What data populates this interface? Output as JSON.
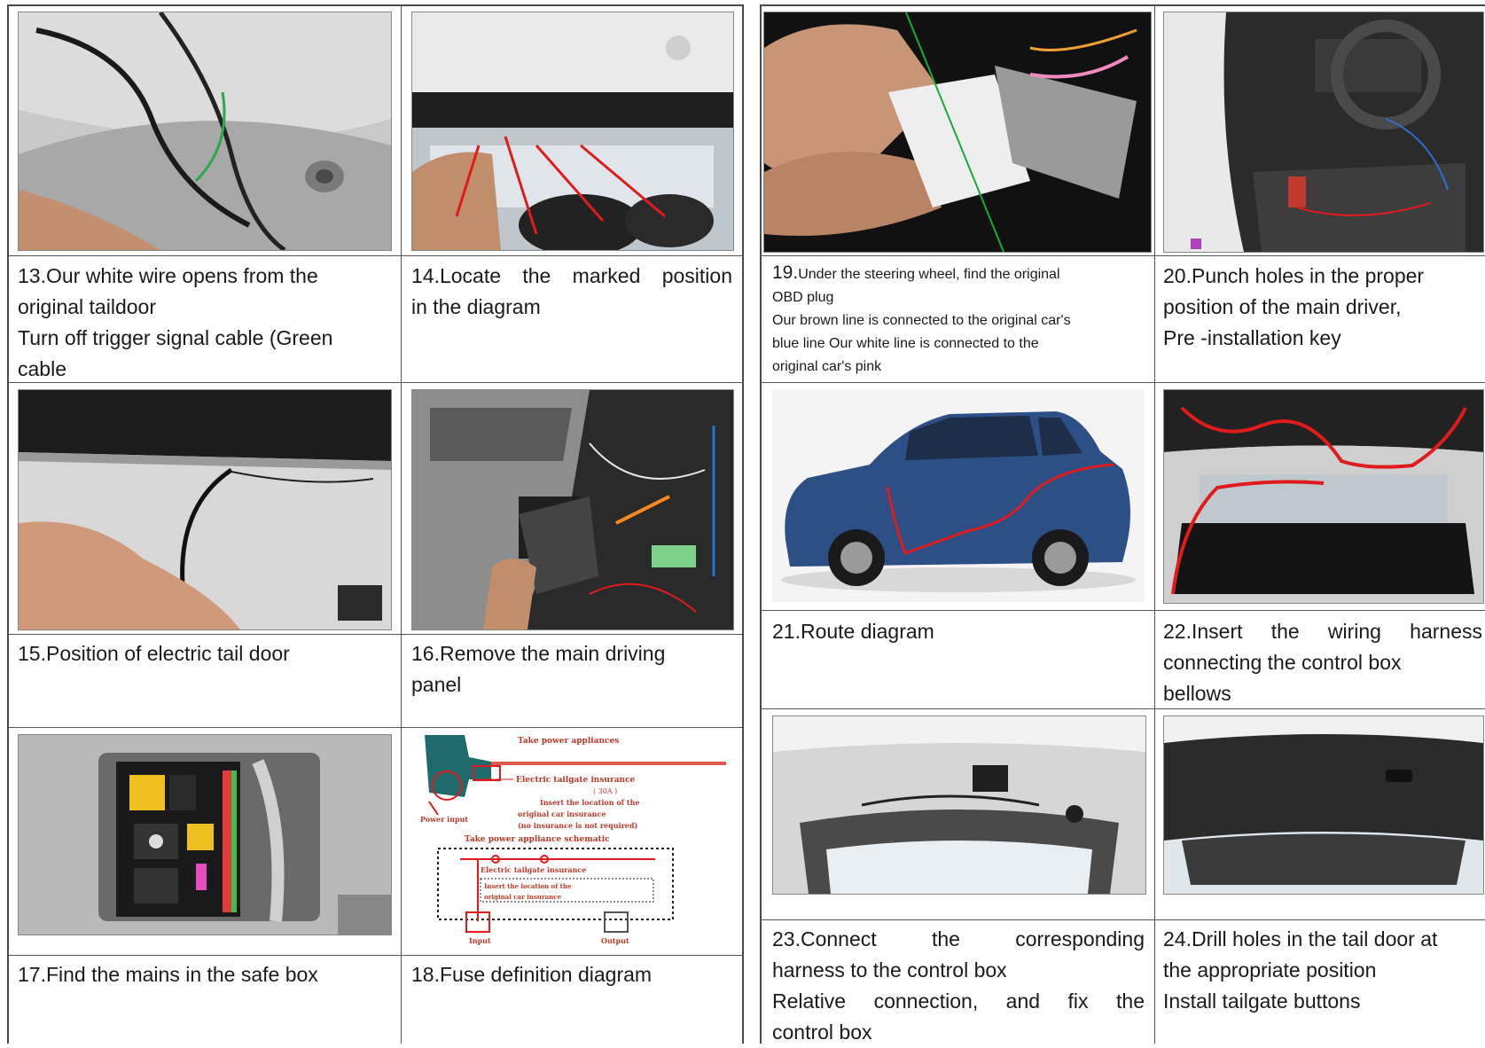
{
  "left": {
    "step13": {
      "lines": [
        "13.Our white wire opens from the",
        "original taildoor",
        "Turn off trigger signal cable (Green",
        "cable"
      ]
    },
    "step14": {
      "lines": [
        "14.Locate the marked position",
        "in the diagram"
      ]
    },
    "step15": {
      "lines": [
        "15.Position of electric tail door"
      ]
    },
    "step16": {
      "lines": [
        "16.Remove the main driving",
        "panel"
      ]
    },
    "step17": {
      "lines": [
        "17.Find the mains in the safe box"
      ]
    },
    "step18": {
      "lines": [
        "18.Fuse definition diagram"
      ],
      "diagram": {
        "top_label": "Take power appliances",
        "fuse_label": "Electric tailgate insurance",
        "amp": "( 30A )",
        "insert_label": "Insert the location of the",
        "insert_label2": "original car insurance",
        "note": "(no insurance is not required)",
        "power_input": "Power input",
        "schematic_title": "Take power appliance schematic",
        "schematic_fuse": "Electric tailgate insurance",
        "schematic_insert": "Insert the location of the",
        "schematic_insert2": "original car insurance",
        "input": "Input",
        "output": "Output"
      }
    }
  },
  "right": {
    "step19": {
      "first": "19.",
      "lines": [
        "Under the steering wheel, find the original",
        "OBD plug",
        "Our brown line is connected to the original car's",
        "blue line Our white line is connected to the",
        "original car's pink"
      ]
    },
    "step20": {
      "lines": [
        "20.Punch holes in the proper",
        "position of the main driver,",
        "Pre -installation key"
      ]
    },
    "step21": {
      "lines": [
        "21.Route diagram"
      ]
    },
    "step22": {
      "lines": [
        "22.Insert the wiring harness",
        "connecting the control box",
        "bellows"
      ]
    },
    "step23": {
      "lines": [
        "23.Connect the corresponding",
        "harness to the control box",
        "Relative connection, and fix the",
        "control box"
      ]
    },
    "step24": {
      "lines": [
        "24.Drill holes in the tail door at",
        "the appropriate position",
        "Install tailgate buttons"
      ]
    }
  },
  "colors": {
    "border": "#4a4a4a",
    "route_red": "#e01b1b",
    "car_blue": "#2c4f86"
  }
}
